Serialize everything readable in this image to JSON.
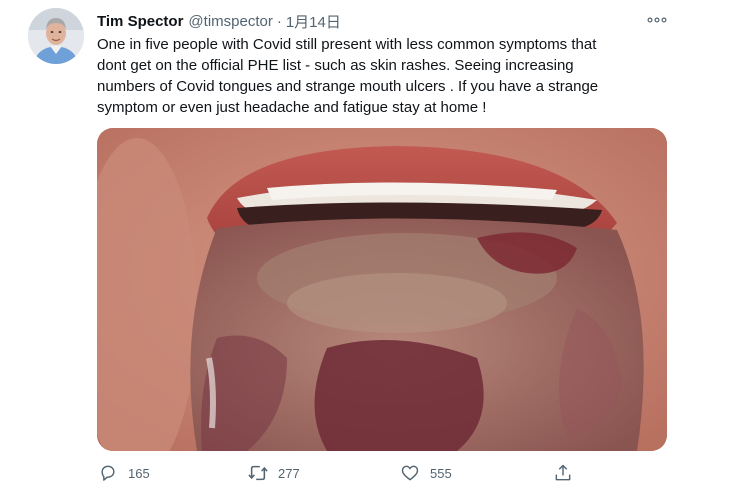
{
  "author": {
    "name": "Tim Spector",
    "handle": "@timspector",
    "separator": "·",
    "date": "1月14日"
  },
  "tweet": {
    "text_lines": [
      "One in five people with Covid still present with less common symptoms that",
      "dont get on the official PHE list - such as skin rashes. Seeing increasing",
      "numbers of Covid tongues and strange mouth ulcers . If you have a strange",
      "symptom or even just headache and fatigue stay at home !"
    ]
  },
  "media": {
    "subject": "photo-close-up-of-tongue"
  },
  "actions": {
    "reply": {
      "icon": "reply-icon",
      "count": "165"
    },
    "retweet": {
      "icon": "retweet-icon",
      "count": "277"
    },
    "like": {
      "icon": "heart-icon",
      "count": "555"
    },
    "share": {
      "icon": "share-icon"
    }
  },
  "colors": {
    "text": "#0f1419",
    "secondary": "#536471"
  }
}
